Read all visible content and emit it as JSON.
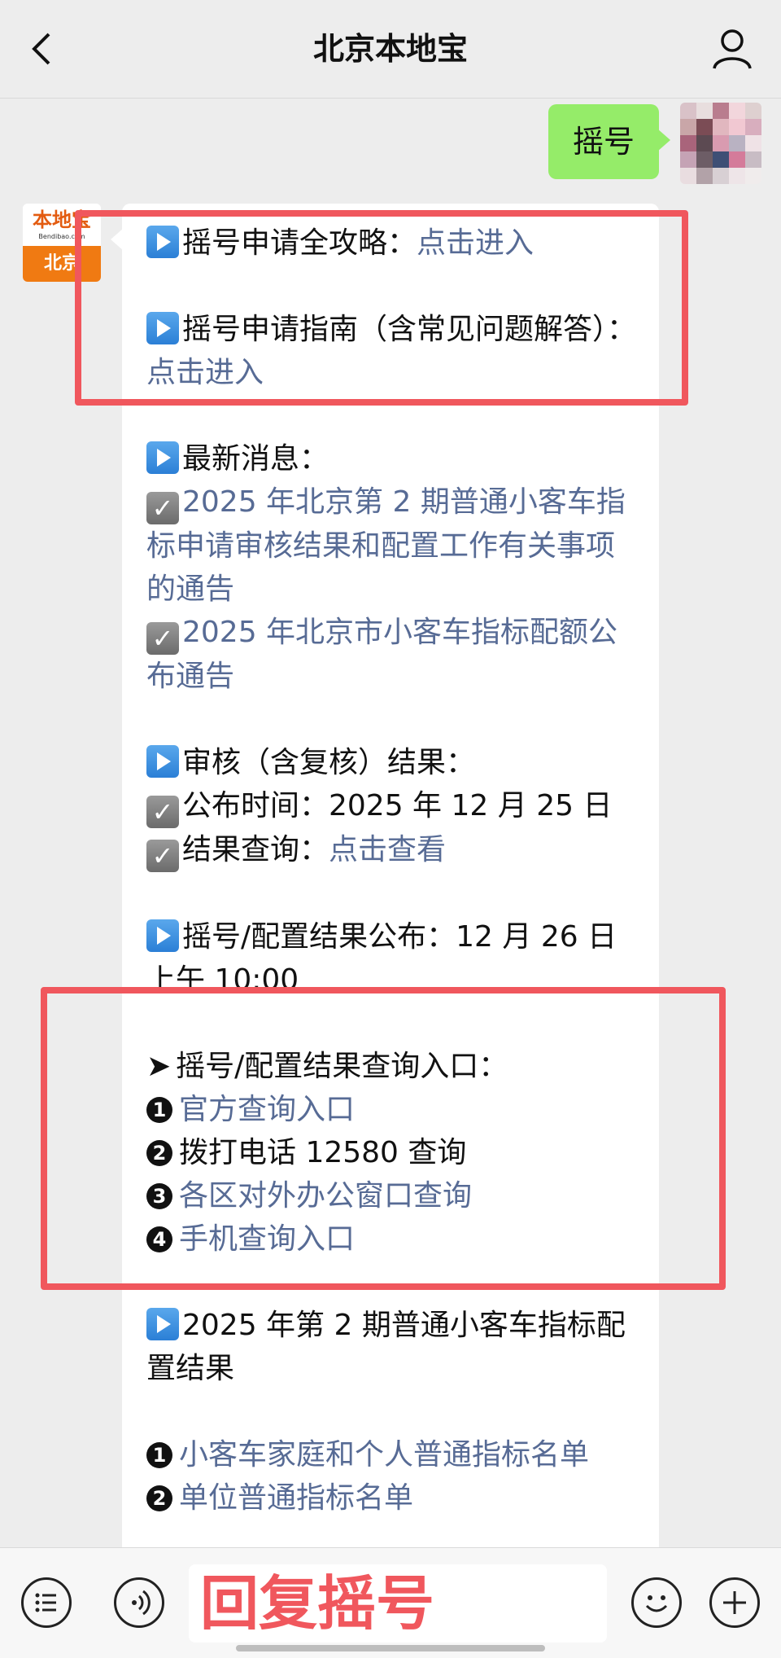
{
  "header": {
    "title": "北京本地宝"
  },
  "user_message": {
    "text": "摇号"
  },
  "bot_avatar": {
    "top_text": "本地宝",
    "url_text": "Bendibao.com",
    "bottom_text": "北京"
  },
  "content": {
    "l1_label": "摇号申请全攻略：",
    "l1_link": "点击进入",
    "l2_label": "摇号申请指南（含常见问题解答）：",
    "l2_link": "点击进入",
    "news_title": "最新消息：",
    "news_1": "2025 年北京第 2 期普通小客车指标申请审核结果和配置工作有关事项的通告",
    "news_2": "2025 年北京市小客车指标配额公布通告",
    "review_title": "审核（含复核）结果：",
    "review_time": "公布时间：2025 年 12 月 25 日",
    "review_query_label": "结果查询：",
    "review_query_link": "点击查看",
    "lottery_publish": "摇号/配置结果公布：12 月 26 日上午 10:00",
    "query_title": "摇号/配置结果查询入口：",
    "query_1": "官方查询入口",
    "query_2": "拨打电话 12580 查询",
    "query_3": "各区对外办公窗口查询",
    "query_4": "手机查询入口",
    "result_title": "2025 年第 2 期普通小客车指标配置结果",
    "result_1": "小客车家庭和个人普通指标名单",
    "result_2": "单位普通指标名单"
  },
  "numbers": {
    "n1": "❶",
    "n2": "❷",
    "n3": "❸",
    "n4": "❹"
  },
  "input": {
    "text": "回复摇号"
  },
  "icons": {
    "back": "chevron-left-icon",
    "profile": "person-icon",
    "menu": "list-icon",
    "voice": "voice-icon",
    "emoji": "emoji-icon",
    "add": "plus-icon"
  },
  "colors": {
    "link": "#576b95",
    "user_bubble": "#95ec69",
    "highlight": "#f0575d"
  }
}
